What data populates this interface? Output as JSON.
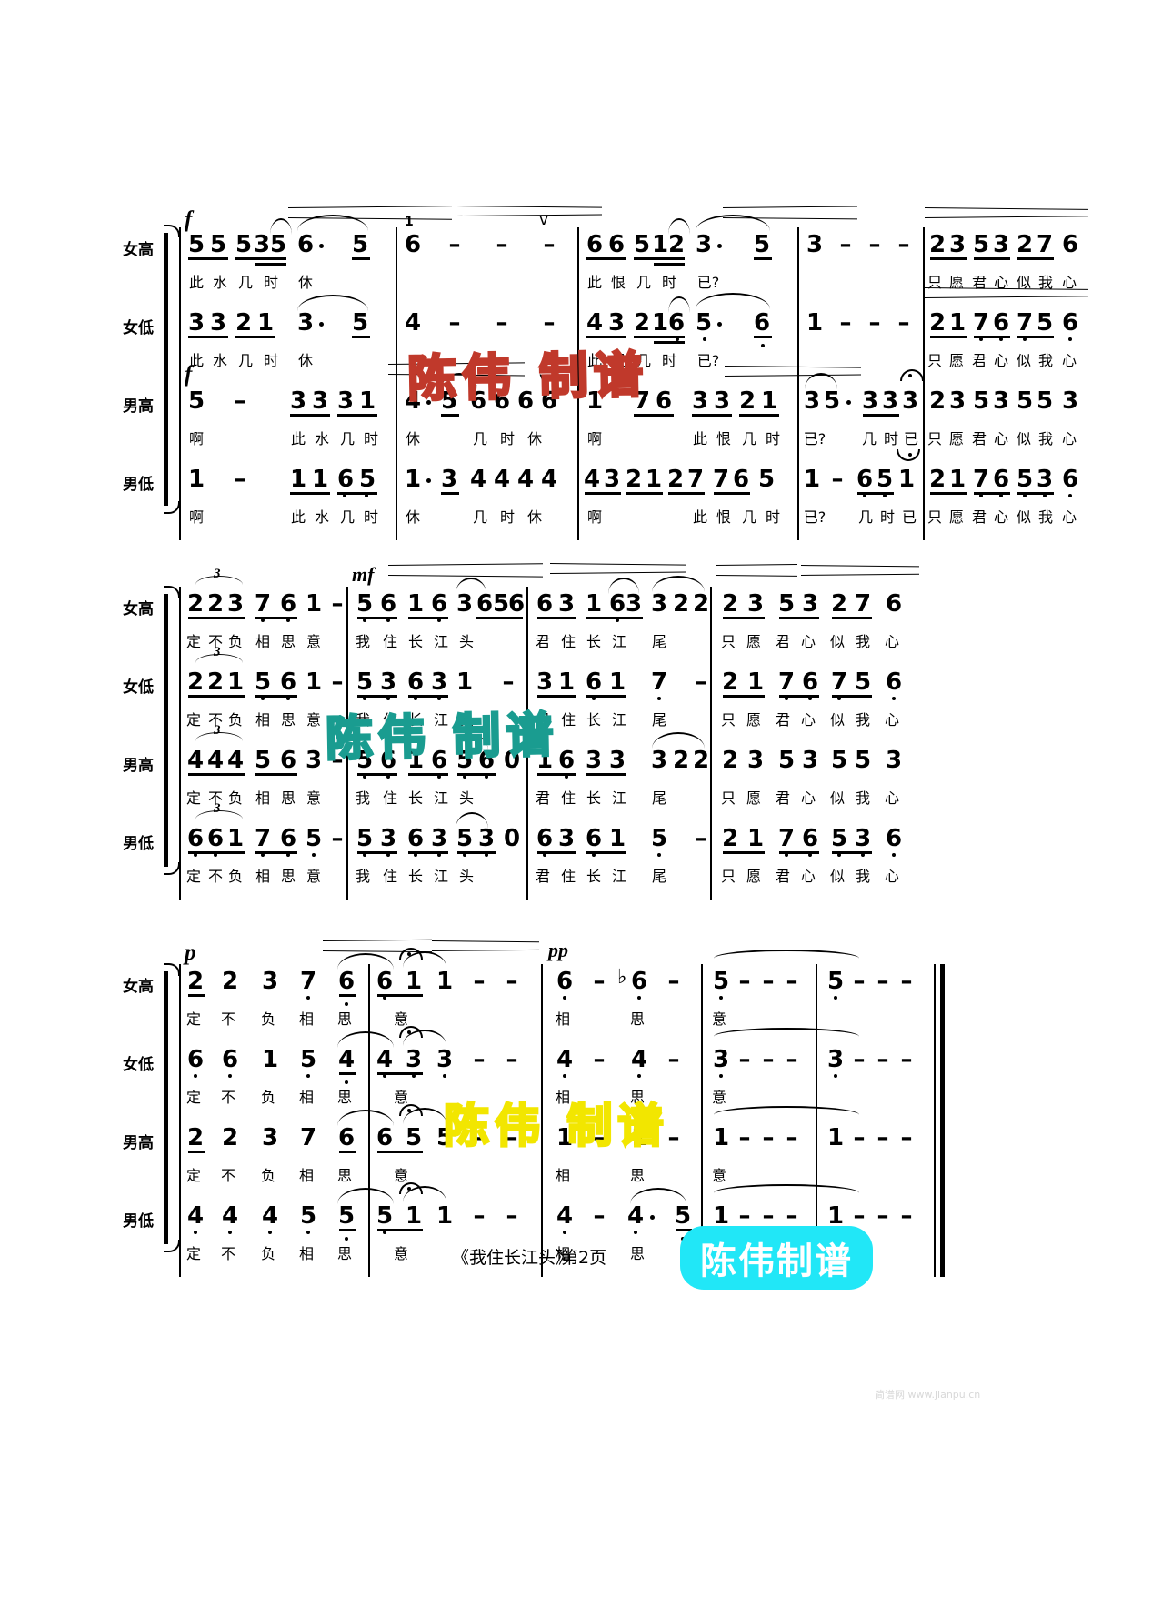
{
  "page": {
    "footer_title": "《我住长江头》",
    "footer_page": "第2页",
    "faint_note": "简谱网 www.jianpu.cn"
  },
  "watermarks": [
    {
      "text": "陈伟  制谱",
      "color": "#c0392b",
      "style": "red"
    },
    {
      "text": "陈伟  制谱",
      "color": "#1a9c90",
      "style": "teal"
    },
    {
      "text": "陈伟  制谱",
      "color": "#f2e600",
      "style": "yellow"
    },
    {
      "text": "陈伟制谱",
      "color": "#21e7f7",
      "style": "badge"
    }
  ],
  "voice_labels": {
    "soprano": "女高",
    "alto": "女低",
    "tenor": "男高",
    "bass": "男低"
  },
  "dynamics": {
    "f": "f",
    "mf": "mf",
    "p": "p",
    "pp": "pp"
  },
  "systems": [
    {
      "id": "system-1",
      "voices": [
        {
          "voice": "soprano",
          "notes": [
            "5",
            "5",
            "5",
            "3",
            "5",
            "6",
            "·",
            "5",
            "6",
            "–",
            "–",
            "–",
            "6",
            "6",
            "5",
            "1",
            "2",
            "3",
            "·",
            "5",
            "3",
            "–",
            "–",
            "–",
            "2",
            "3",
            "5",
            "3",
            "2",
            "7",
            "6"
          ],
          "lyrics": [
            "此",
            "水",
            "几",
            "时",
            "休",
            "此",
            "恨",
            "几",
            "时",
            "已?",
            "只",
            "愿",
            "君",
            "心",
            "似",
            "我",
            "心"
          ]
        },
        {
          "voice": "alto",
          "notes": [
            "3",
            "3",
            "2",
            "1",
            "3",
            "·",
            "5",
            "4",
            "–",
            "–",
            "–",
            "4",
            "3",
            "2",
            "1",
            "6",
            "5",
            "·",
            "6",
            "1",
            "–",
            "–",
            "–",
            "2",
            "1",
            "7",
            "6",
            "7",
            "5",
            "6"
          ],
          "lyrics": [
            "此",
            "水",
            "几",
            "时",
            "休",
            "此",
            "恨",
            "几",
            "时",
            "已?",
            "只",
            "愿",
            "君",
            "心",
            "似",
            "我",
            "心"
          ]
        },
        {
          "voice": "tenor",
          "notes": [
            "5",
            "–",
            "3",
            "3",
            "3",
            "1",
            "4",
            "·",
            "5",
            "6",
            "6",
            "6",
            "6",
            "1",
            "7",
            "6",
            "3",
            "3",
            "2",
            "1",
            "3",
            "5",
            "·",
            "3",
            "3",
            "3",
            "2",
            "3",
            "5",
            "3",
            "5",
            "5",
            "3"
          ],
          "lyrics": [
            "啊",
            "此",
            "水",
            "几",
            "时",
            "休",
            "几",
            "时",
            "休",
            "啊",
            "此",
            "恨",
            "几",
            "时",
            "已?",
            "几",
            "时",
            "已",
            "只",
            "愿",
            "君",
            "心",
            "似",
            "我",
            "心"
          ]
        },
        {
          "voice": "bass",
          "notes": [
            "1",
            "–",
            "1",
            "1",
            "6",
            "5",
            "1",
            "·",
            "3",
            "4",
            "4",
            "4",
            "4",
            "3",
            "2",
            "1",
            "2",
            "7",
            "7",
            "6",
            "5",
            "1",
            "–",
            "6",
            "5",
            "1",
            "2",
            "1",
            "7",
            "6",
            "5",
            "3",
            "6"
          ],
          "lyrics": [
            "啊",
            "此",
            "水",
            "几",
            "时",
            "休",
            "几",
            "时",
            "休",
            "啊",
            "此",
            "恨",
            "几",
            "时",
            "已?",
            "几",
            "时",
            "已",
            "只",
            "愿",
            "君",
            "心",
            "似",
            "我",
            "心"
          ]
        }
      ]
    },
    {
      "id": "system-2",
      "voices": [
        {
          "voice": "soprano",
          "notes": [
            "2",
            "2",
            "3",
            "7",
            "6",
            "1",
            "–",
            "5",
            "6",
            "1",
            "6",
            "3",
            "6",
            "5",
            "6",
            "3",
            "6",
            "3",
            "1",
            "6",
            "3",
            "3",
            "2",
            "2",
            "2",
            "3",
            "5",
            "3",
            "2",
            "7",
            "6"
          ],
          "lyrics": [
            "定",
            "不",
            "负",
            "相",
            "思",
            "意",
            "我",
            "住",
            "长",
            "江",
            "头",
            "君",
            "住",
            "长",
            "江",
            "尾",
            "只",
            "愿",
            "君",
            "心",
            "似",
            "我",
            "心"
          ]
        },
        {
          "voice": "alto",
          "notes": [
            "2",
            "2",
            "1",
            "5",
            "6",
            "1",
            "–",
            "5",
            "3",
            "6",
            "3",
            "1",
            "–",
            "3",
            "1",
            "6",
            "1",
            "7",
            "–",
            "2",
            "1",
            "7",
            "6",
            "7",
            "5",
            "6"
          ],
          "lyrics": [
            "定",
            "不",
            "负",
            "相",
            "思",
            "意",
            "我",
            "住",
            "长",
            "江",
            "君",
            "住",
            "长",
            "江",
            "尾",
            "只",
            "愿",
            "君",
            "心",
            "似",
            "我",
            "心"
          ]
        },
        {
          "voice": "tenor",
          "notes": [
            "4",
            "4",
            "4",
            "5",
            "6",
            "3",
            "–",
            "5",
            "6",
            "1",
            "6",
            "5",
            "6",
            "0",
            "1",
            "6",
            "3",
            "3",
            "3",
            "2",
            "2",
            "2",
            "3",
            "5",
            "3",
            "5",
            "5",
            "3"
          ],
          "lyrics": [
            "定",
            "不",
            "负",
            "相",
            "思",
            "意",
            "我",
            "住",
            "长",
            "江",
            "头",
            "君",
            "住",
            "长",
            "江",
            "尾",
            "只",
            "愿",
            "君",
            "心",
            "似",
            "我",
            "心"
          ]
        },
        {
          "voice": "bass",
          "notes": [
            "6",
            "6",
            "1",
            "7",
            "6",
            "5",
            "–",
            "5",
            "3",
            "6",
            "3",
            "5",
            "3",
            "0",
            "6",
            "3",
            "6",
            "1",
            "5",
            "–",
            "2",
            "1",
            "7",
            "6",
            "5",
            "3",
            "6"
          ],
          "lyrics": [
            "定",
            "不",
            "负",
            "相",
            "思",
            "意",
            "我",
            "住",
            "长",
            "江",
            "头",
            "君",
            "住",
            "长",
            "江",
            "尾",
            "只",
            "愿",
            "君",
            "心",
            "似",
            "我",
            "心"
          ]
        }
      ]
    },
    {
      "id": "system-3",
      "voices": [
        {
          "voice": "soprano",
          "notes": [
            "2",
            "2",
            "3",
            "7",
            "6",
            "6",
            "1",
            "1",
            "–",
            "–",
            "6",
            "–",
            "♭6",
            "–",
            "5",
            "–",
            "–",
            "–",
            "5",
            "–",
            "–",
            "–"
          ],
          "lyrics": [
            "定",
            "不",
            "负",
            "相",
            "思",
            "意",
            "相",
            "思",
            "意"
          ]
        },
        {
          "voice": "alto",
          "notes": [
            "6",
            "6",
            "1",
            "5",
            "4",
            "4",
            "3",
            "3",
            "–",
            "–",
            "4",
            "–",
            "4",
            "–",
            "3",
            "–",
            "–",
            "–",
            "3",
            "–",
            "–",
            "–"
          ],
          "lyrics": [
            "定",
            "不",
            "负",
            "相",
            "思",
            "意",
            "相",
            "思",
            "意"
          ]
        },
        {
          "voice": "tenor",
          "notes": [
            "2",
            "2",
            "3",
            "7",
            "6",
            "6",
            "5",
            "5",
            "–",
            "–",
            "1",
            "–",
            "1",
            "–",
            "1",
            "–",
            "–",
            "–",
            "1",
            "–",
            "–",
            "–"
          ],
          "lyrics": [
            "定",
            "不",
            "负",
            "相",
            "思",
            "意",
            "相",
            "思",
            "意"
          ]
        },
        {
          "voice": "bass",
          "notes": [
            "4",
            "4",
            "4",
            "5",
            "5",
            "5",
            "1",
            "1",
            "–",
            "–",
            "4",
            "–",
            "4",
            "·",
            "5",
            "1",
            "–",
            "–",
            "–",
            "1",
            "–",
            "–",
            "–"
          ],
          "lyrics": [
            "定",
            "不",
            "负",
            "相",
            "思",
            "意",
            "相",
            "思",
            "意"
          ]
        }
      ]
    }
  ]
}
